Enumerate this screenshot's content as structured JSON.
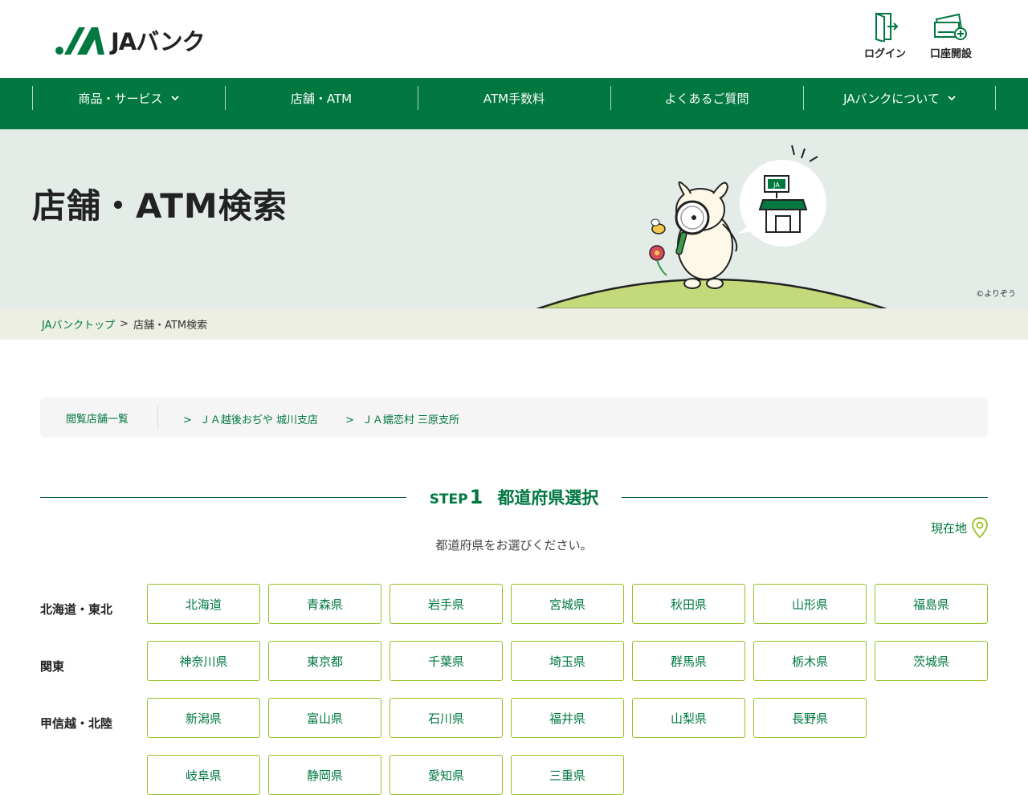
{
  "header": {
    "logo_text": "JAバンク",
    "login_label": "ログイン",
    "account_label": "口座開設"
  },
  "nav": {
    "items": [
      {
        "label": "商品・サービス",
        "dropdown": true
      },
      {
        "label": "店舗・ATM",
        "dropdown": false
      },
      {
        "label": "ATM手数料",
        "dropdown": false
      },
      {
        "label": "よくあるご質問",
        "dropdown": false
      },
      {
        "label": "JAバンクについて",
        "dropdown": true
      }
    ]
  },
  "hero": {
    "title": "店舗・ATM検索",
    "copyright": "©よりぞう",
    "sign_text": "JA"
  },
  "breadcrumb": {
    "home": "JAバンクトップ",
    "separator": ">",
    "current": "店舗・ATM検索"
  },
  "history": {
    "label": "閲覧店舗一覧",
    "links": [
      "ＪＡ越後おぢや 城川支店",
      "ＪＡ嬬恋村 三原支所"
    ]
  },
  "step": {
    "step_label": "STEP",
    "number": "1",
    "title": "都道府県選択",
    "location_label": "現在地",
    "instruction": "都道府県をお選びください。"
  },
  "regions": [
    {
      "name": "北海道・東北",
      "prefectures": [
        "北海道",
        "青森県",
        "岩手県",
        "宮城県",
        "秋田県",
        "山形県",
        "福島県"
      ]
    },
    {
      "name": "関東",
      "prefectures": [
        "神奈川県",
        "東京都",
        "千葉県",
        "埼玉県",
        "群馬県",
        "栃木県",
        "茨城県"
      ]
    },
    {
      "name": "甲信越・北陸",
      "prefectures": [
        "新潟県",
        "富山県",
        "石川県",
        "福井県",
        "山梨県",
        "長野県"
      ]
    },
    {
      "name": "",
      "prefectures": [
        "岐阜県",
        "静岡県",
        "愛知県",
        "三重県"
      ]
    }
  ],
  "colors": {
    "brand_green": "#007840",
    "button_border": "#94c11f",
    "hero_bg": "#e4ece8",
    "breadcrumb_bg": "#edeee4",
    "hill": "#c4d97a"
  }
}
